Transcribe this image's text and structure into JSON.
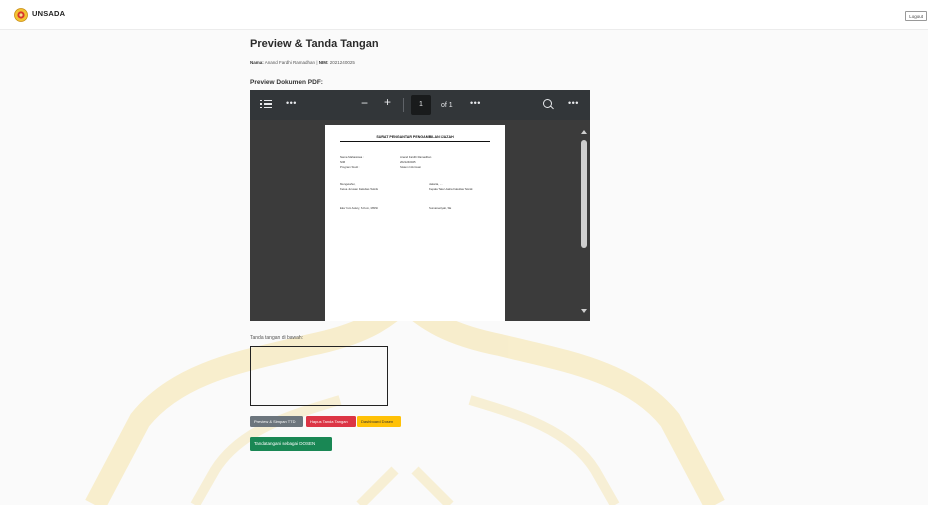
{
  "colors": {
    "watermark": "#f5e3a8",
    "toolbar_bg": "#323639",
    "viewer_bg": "#3b3b3b",
    "btn_secondary": "#6c757d",
    "btn_danger": "#dc3545",
    "btn_warning": "#ffc107",
    "btn_success": "#198754"
  },
  "navbar": {
    "brand": "UNSADA",
    "logo_icon": "university-logo-icon",
    "logout_label": "Logout"
  },
  "page": {
    "title": "Preview & Tanda Tangan",
    "name_label": "Nama:",
    "name_value": "Anand Fardhi Ramadhan",
    "separator": "|",
    "nim_label": "NIM:",
    "nim_value": "2021240025",
    "preview_label": "Preview Dokumen PDF:"
  },
  "pdf_viewer": {
    "toolbar": {
      "outline_icon": "list-icon",
      "more_icon": "more-horizontal-icon",
      "zoom_out": "−",
      "zoom_in": "+",
      "current_page": "1",
      "page_total": "of 1",
      "search_icon": "search-icon"
    },
    "document": {
      "title": "SURAT PENGANTAR PENGAMBILAN IJAZAH",
      "lines": {
        "name_label": "Nama Mahasiswa  :",
        "name_value": "Anand Fardhi Ramadhan",
        "nim_label": "NIM",
        "nim_value": "2021240025",
        "prodi_label": "Program Studi    :",
        "prodi_value": "Sistem Informasi",
        "left_heading": "Mengetahui,",
        "left_role": "Ketua Jurusan Fakultas Teknik",
        "right_heading": "Jakarta, ....",
        "right_role": "Kepala Tata Usaha Fakultas Teknik",
        "left_signer": "Eka Yuni Astuty, S.Kom, MMSI",
        "right_signer": "Sumarsetiyati, SE"
      }
    }
  },
  "signature": {
    "label": "Tanda tangan di bawah:",
    "buttons": {
      "preview": "Preview & Simpan TTD",
      "clear": "Hapus Tanda Tangan",
      "dashboard": "Dashboard Dosen",
      "sign": "Tandatangani sebagai DOSEN"
    }
  }
}
